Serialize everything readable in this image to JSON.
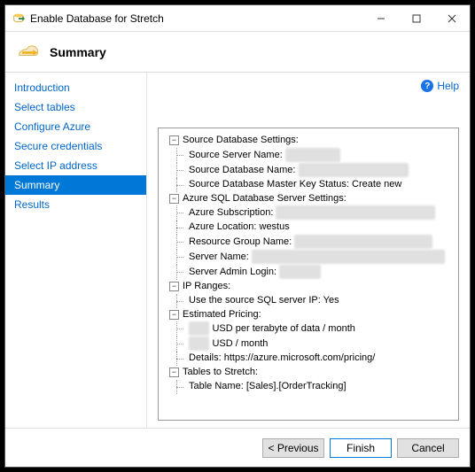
{
  "window": {
    "title": "Enable Database for Stretch"
  },
  "header": {
    "title": "Summary"
  },
  "nav": {
    "items": [
      {
        "label": "Introduction"
      },
      {
        "label": "Select tables"
      },
      {
        "label": "Configure Azure"
      },
      {
        "label": "Secure credentials"
      },
      {
        "label": "Select IP address"
      },
      {
        "label": "Summary"
      },
      {
        "label": "Results"
      }
    ],
    "active_index": 5
  },
  "help": {
    "label": "Help"
  },
  "tree": {
    "sections": [
      {
        "label": "Source Database Settings:",
        "children": [
          {
            "key": "Source Server Name:",
            "redacted": true,
            "value": "████████"
          },
          {
            "key": "Source Database Name:",
            "redacted": true,
            "value": "████████████████"
          },
          {
            "key": "Source Database Master Key Status:",
            "redacted": false,
            "value": "Create new"
          }
        ]
      },
      {
        "label": "Azure SQL Database Server Settings:",
        "children": [
          {
            "key": "Azure Subscription:",
            "redacted": true,
            "value": "███████████████████████"
          },
          {
            "key": "Azure Location:",
            "redacted": false,
            "value": "westus"
          },
          {
            "key": "Resource Group Name:",
            "redacted": true,
            "value": "████████████████████"
          },
          {
            "key": "Server Name:",
            "redacted": true,
            "value": "████████████████████████████"
          },
          {
            "key": "Server Admin Login:",
            "redacted": true,
            "value": "██████"
          }
        ]
      },
      {
        "label": "IP Ranges:",
        "children": [
          {
            "key": "Use the source SQL server IP:",
            "redacted": false,
            "value": "Yes"
          }
        ]
      },
      {
        "label": "Estimated Pricing:",
        "children": [
          {
            "prefix_redacted": true,
            "key_after": "USD per terabyte of data / month",
            "value": ""
          },
          {
            "prefix_redacted": true,
            "key_after": "USD / month",
            "value": ""
          },
          {
            "key": "Details:",
            "redacted": false,
            "value": "https://azure.microsoft.com/pricing/"
          }
        ]
      },
      {
        "label": "Tables to Stretch:",
        "children": [
          {
            "key": "Table Name:",
            "redacted": false,
            "value": "[Sales].[OrderTracking]"
          }
        ]
      }
    ]
  },
  "footer": {
    "previous": "< Previous",
    "finish": "Finish",
    "cancel": "Cancel"
  }
}
